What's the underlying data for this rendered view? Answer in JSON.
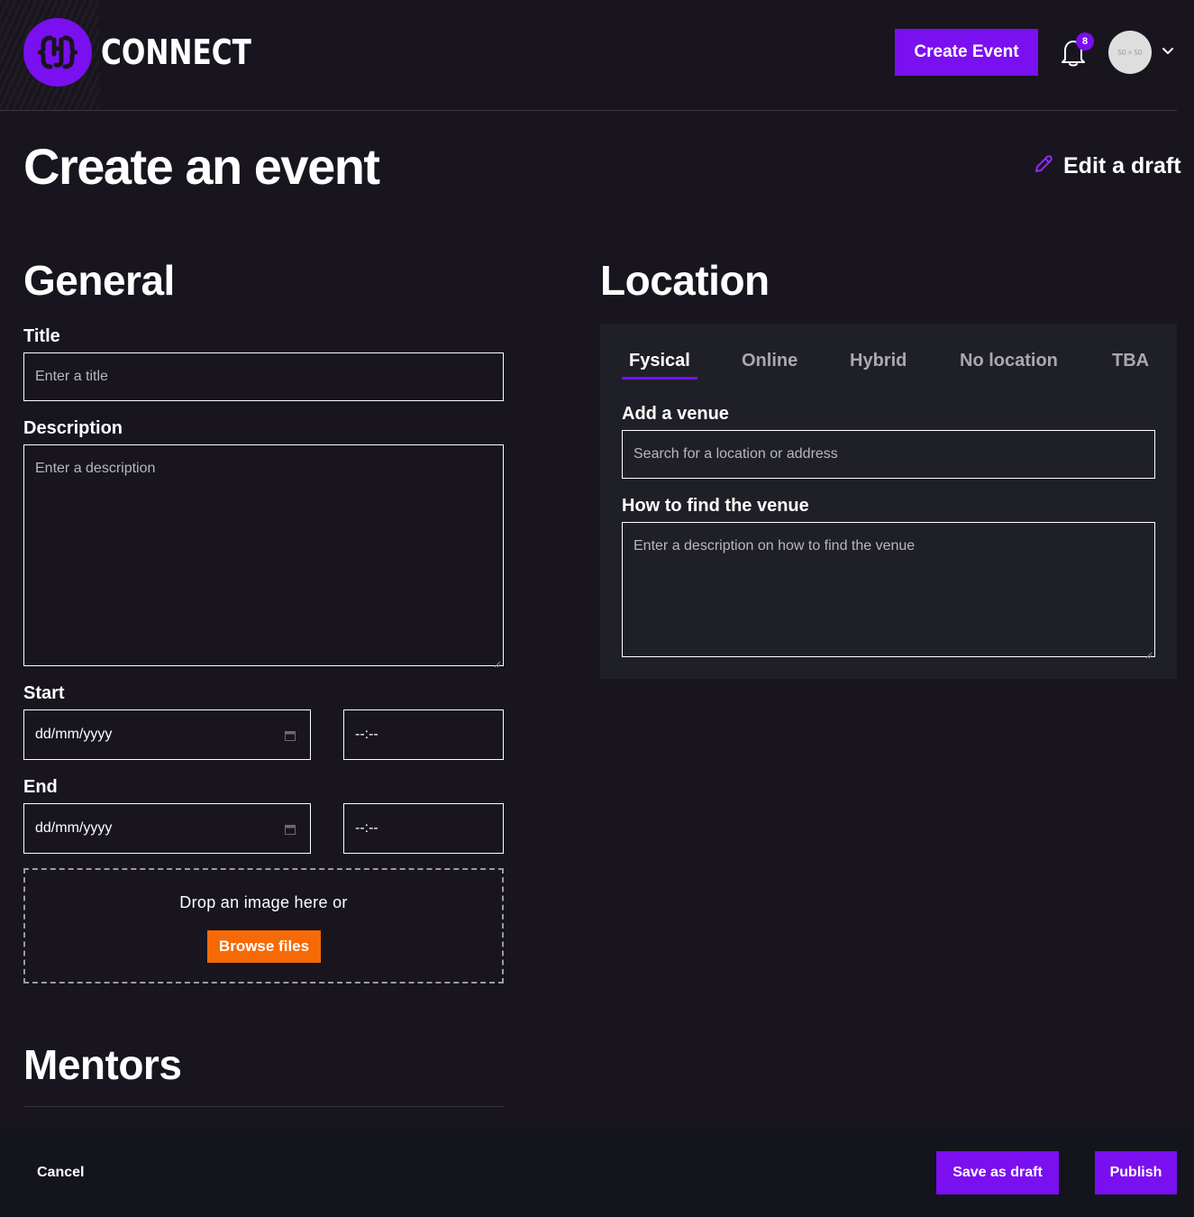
{
  "header": {
    "brand": "CONNECT",
    "create_event_label": "Create Event",
    "notification_count": "8",
    "avatar_placeholder": "50 × 50"
  },
  "page": {
    "title": "Create an event",
    "edit_draft_label": "Edit a draft"
  },
  "general": {
    "heading": "General",
    "title_label": "Title",
    "title_placeholder": "Enter a title",
    "description_label": "Description",
    "description_placeholder": "Enter a description",
    "start_label": "Start",
    "start_date_placeholder": "dd/mm/yyyy",
    "start_time_placeholder": "--:--",
    "end_label": "End",
    "end_date_placeholder": "dd/mm/yyyy",
    "end_time_placeholder": "--:--",
    "dropzone_text": "Drop an image here or",
    "browse_label": "Browse files"
  },
  "mentors": {
    "heading": "Mentors"
  },
  "location": {
    "heading": "Location",
    "tabs": [
      {
        "label": "Fysical",
        "active": true
      },
      {
        "label": "Online",
        "active": false
      },
      {
        "label": "Hybrid",
        "active": false
      },
      {
        "label": "No location",
        "active": false
      },
      {
        "label": "TBA",
        "active": false
      }
    ],
    "venue_label": "Add a venue",
    "venue_placeholder": "Search for a location or address",
    "find_label": "How to find the venue",
    "find_placeholder": "Enter a description on how to find the venue"
  },
  "footer": {
    "cancel_label": "Cancel",
    "save_draft_label": "Save as draft",
    "publish_label": "Publish"
  },
  "colors": {
    "background": "#18151f",
    "accent": "#7a0ff0",
    "browse": "#f56a06",
    "panel": "#1f2027",
    "footer": "#13141c"
  },
  "icons": {
    "logo": "connect-logo-icon",
    "notifications": "bell-icon",
    "account_menu": "chevron-down-icon",
    "edit_draft": "pencil-icon",
    "date_picker": "calendar-icon"
  }
}
